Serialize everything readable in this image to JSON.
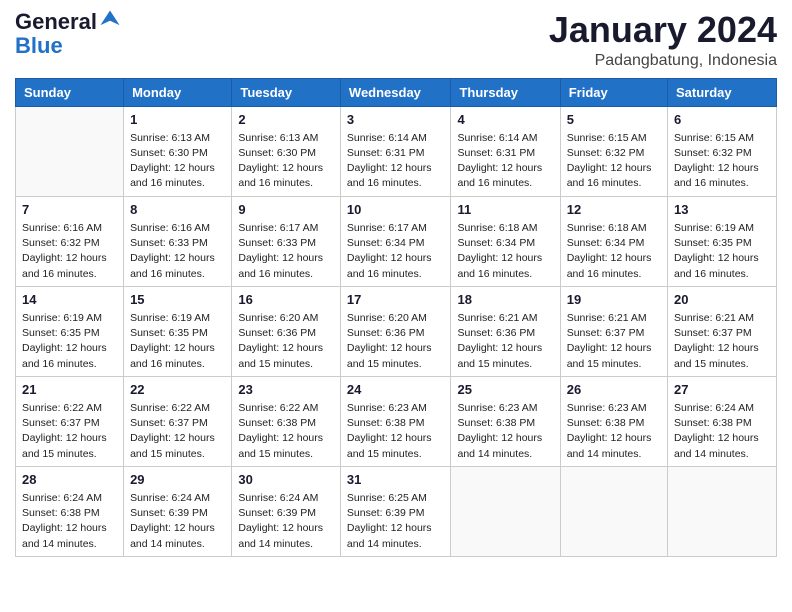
{
  "logo": {
    "line1": "General",
    "line2": "Blue",
    "bird_unicode": "▲"
  },
  "title": {
    "month_year": "January 2024",
    "location": "Padangbatung, Indonesia"
  },
  "weekdays": [
    "Sunday",
    "Monday",
    "Tuesday",
    "Wednesday",
    "Thursday",
    "Friday",
    "Saturday"
  ],
  "weeks": [
    [
      {
        "day": "",
        "info": ""
      },
      {
        "day": "1",
        "info": "Sunrise: 6:13 AM\nSunset: 6:30 PM\nDaylight: 12 hours\nand 16 minutes."
      },
      {
        "day": "2",
        "info": "Sunrise: 6:13 AM\nSunset: 6:30 PM\nDaylight: 12 hours\nand 16 minutes."
      },
      {
        "day": "3",
        "info": "Sunrise: 6:14 AM\nSunset: 6:31 PM\nDaylight: 12 hours\nand 16 minutes."
      },
      {
        "day": "4",
        "info": "Sunrise: 6:14 AM\nSunset: 6:31 PM\nDaylight: 12 hours\nand 16 minutes."
      },
      {
        "day": "5",
        "info": "Sunrise: 6:15 AM\nSunset: 6:32 PM\nDaylight: 12 hours\nand 16 minutes."
      },
      {
        "day": "6",
        "info": "Sunrise: 6:15 AM\nSunset: 6:32 PM\nDaylight: 12 hours\nand 16 minutes."
      }
    ],
    [
      {
        "day": "7",
        "info": "Sunrise: 6:16 AM\nSunset: 6:32 PM\nDaylight: 12 hours\nand 16 minutes."
      },
      {
        "day": "8",
        "info": "Sunrise: 6:16 AM\nSunset: 6:33 PM\nDaylight: 12 hours\nand 16 minutes."
      },
      {
        "day": "9",
        "info": "Sunrise: 6:17 AM\nSunset: 6:33 PM\nDaylight: 12 hours\nand 16 minutes."
      },
      {
        "day": "10",
        "info": "Sunrise: 6:17 AM\nSunset: 6:34 PM\nDaylight: 12 hours\nand 16 minutes."
      },
      {
        "day": "11",
        "info": "Sunrise: 6:18 AM\nSunset: 6:34 PM\nDaylight: 12 hours\nand 16 minutes."
      },
      {
        "day": "12",
        "info": "Sunrise: 6:18 AM\nSunset: 6:34 PM\nDaylight: 12 hours\nand 16 minutes."
      },
      {
        "day": "13",
        "info": "Sunrise: 6:19 AM\nSunset: 6:35 PM\nDaylight: 12 hours\nand 16 minutes."
      }
    ],
    [
      {
        "day": "14",
        "info": "Sunrise: 6:19 AM\nSunset: 6:35 PM\nDaylight: 12 hours\nand 16 minutes."
      },
      {
        "day": "15",
        "info": "Sunrise: 6:19 AM\nSunset: 6:35 PM\nDaylight: 12 hours\nand 16 minutes."
      },
      {
        "day": "16",
        "info": "Sunrise: 6:20 AM\nSunset: 6:36 PM\nDaylight: 12 hours\nand 15 minutes."
      },
      {
        "day": "17",
        "info": "Sunrise: 6:20 AM\nSunset: 6:36 PM\nDaylight: 12 hours\nand 15 minutes."
      },
      {
        "day": "18",
        "info": "Sunrise: 6:21 AM\nSunset: 6:36 PM\nDaylight: 12 hours\nand 15 minutes."
      },
      {
        "day": "19",
        "info": "Sunrise: 6:21 AM\nSunset: 6:37 PM\nDaylight: 12 hours\nand 15 minutes."
      },
      {
        "day": "20",
        "info": "Sunrise: 6:21 AM\nSunset: 6:37 PM\nDaylight: 12 hours\nand 15 minutes."
      }
    ],
    [
      {
        "day": "21",
        "info": "Sunrise: 6:22 AM\nSunset: 6:37 PM\nDaylight: 12 hours\nand 15 minutes."
      },
      {
        "day": "22",
        "info": "Sunrise: 6:22 AM\nSunset: 6:37 PM\nDaylight: 12 hours\nand 15 minutes."
      },
      {
        "day": "23",
        "info": "Sunrise: 6:22 AM\nSunset: 6:38 PM\nDaylight: 12 hours\nand 15 minutes."
      },
      {
        "day": "24",
        "info": "Sunrise: 6:23 AM\nSunset: 6:38 PM\nDaylight: 12 hours\nand 15 minutes."
      },
      {
        "day": "25",
        "info": "Sunrise: 6:23 AM\nSunset: 6:38 PM\nDaylight: 12 hours\nand 14 minutes."
      },
      {
        "day": "26",
        "info": "Sunrise: 6:23 AM\nSunset: 6:38 PM\nDaylight: 12 hours\nand 14 minutes."
      },
      {
        "day": "27",
        "info": "Sunrise: 6:24 AM\nSunset: 6:38 PM\nDaylight: 12 hours\nand 14 minutes."
      }
    ],
    [
      {
        "day": "28",
        "info": "Sunrise: 6:24 AM\nSunset: 6:38 PM\nDaylight: 12 hours\nand 14 minutes."
      },
      {
        "day": "29",
        "info": "Sunrise: 6:24 AM\nSunset: 6:39 PM\nDaylight: 12 hours\nand 14 minutes."
      },
      {
        "day": "30",
        "info": "Sunrise: 6:24 AM\nSunset: 6:39 PM\nDaylight: 12 hours\nand 14 minutes."
      },
      {
        "day": "31",
        "info": "Sunrise: 6:25 AM\nSunset: 6:39 PM\nDaylight: 12 hours\nand 14 minutes."
      },
      {
        "day": "",
        "info": ""
      },
      {
        "day": "",
        "info": ""
      },
      {
        "day": "",
        "info": ""
      }
    ]
  ]
}
